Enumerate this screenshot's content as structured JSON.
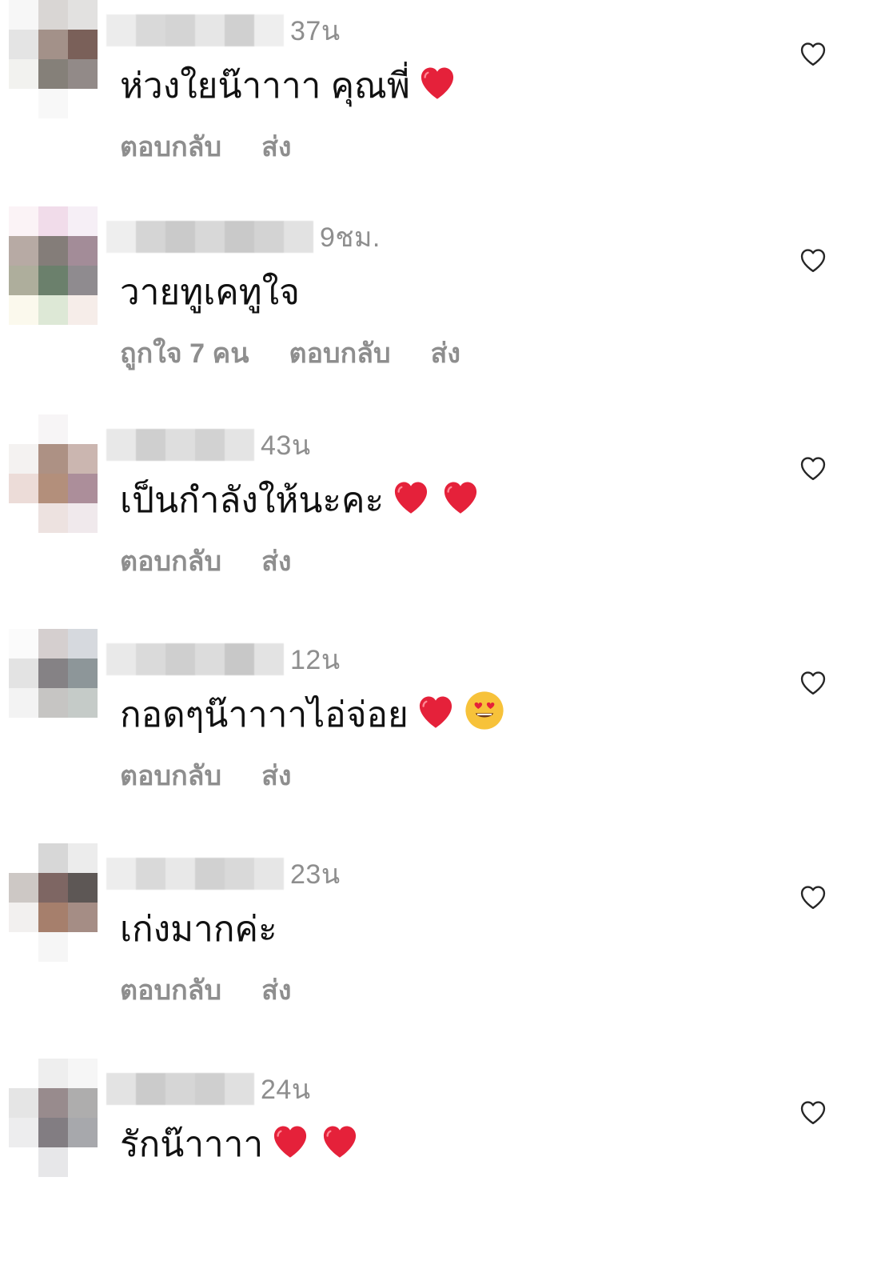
{
  "colors": {
    "text": "#111111",
    "muted": "#8e8e8e",
    "heart": "#e5213a",
    "background": "#ffffff"
  },
  "icons": {
    "like": "heart-outline-icon",
    "emoji_heart": "red-heart-emoji",
    "emoji_love": "heart-eyes-emoji"
  },
  "comments": [
    {
      "timestamp": "37น",
      "text": "ห่วงใยน๊าาาา คุณพี่",
      "emojis": [
        "heart"
      ],
      "likes": "",
      "reply": "ตอบกลับ",
      "send": "ส่ง"
    },
    {
      "timestamp": "9ชม.",
      "text": "วายทูเคทูใจ",
      "emojis": [],
      "likes": "ถูกใจ 7 คน",
      "reply": "ตอบกลับ",
      "send": "ส่ง"
    },
    {
      "timestamp": "43น",
      "text": "เป็นกำลังให้นะคะ ",
      "emojis": [
        "heart",
        "heart"
      ],
      "likes": "",
      "reply": "ตอบกลับ",
      "send": "ส่ง"
    },
    {
      "timestamp": "12น",
      "text": "กอดๆน๊าาาาไอ่จ่อย ",
      "emojis": [
        "heart",
        "love"
      ],
      "likes": "",
      "reply": "ตอบกลับ",
      "send": "ส่ง"
    },
    {
      "timestamp": "23น",
      "text": "เก่งมากค่ะ",
      "emojis": [],
      "likes": "",
      "reply": "ตอบกลับ",
      "send": "ส่ง"
    },
    {
      "timestamp": "24น",
      "text": "รักน๊าาาา",
      "emojis": [
        "heart",
        "heart"
      ],
      "likes": "",
      "reply": "",
      "send": ""
    }
  ]
}
